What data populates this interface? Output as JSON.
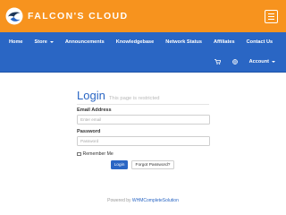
{
  "brand": {
    "name": "FALCON'S CLOUD",
    "logo_icon": "falcon-logo-icon",
    "header_color": "#f7931e",
    "nav_color": "#2a66c4"
  },
  "header": {
    "menu_icon": "hamburger-menu-icon"
  },
  "nav": {
    "items": [
      {
        "label": "Home"
      },
      {
        "label": "Store"
      },
      {
        "label": "Announcements"
      },
      {
        "label": "Knowledgebase"
      },
      {
        "label": "Network Status"
      },
      {
        "label": "Affiliates"
      },
      {
        "label": "Contact Us"
      }
    ],
    "cart_icon": "cart-icon",
    "language_icon": "globe-icon",
    "account_label": "Account"
  },
  "login": {
    "title": "Login",
    "subtitle": "This page is restricted",
    "email_label": "Email Address",
    "email_placeholder": "Enter email",
    "email_value": "",
    "password_label": "Password",
    "password_placeholder": "Password",
    "password_value": "",
    "remember_label": "Remember Me",
    "remember_checked": false,
    "login_button": "Login",
    "forgot_button": "Forgot Password?"
  },
  "footer": {
    "prefix": "Powered by ",
    "link": "WHMCompleteSolution"
  }
}
